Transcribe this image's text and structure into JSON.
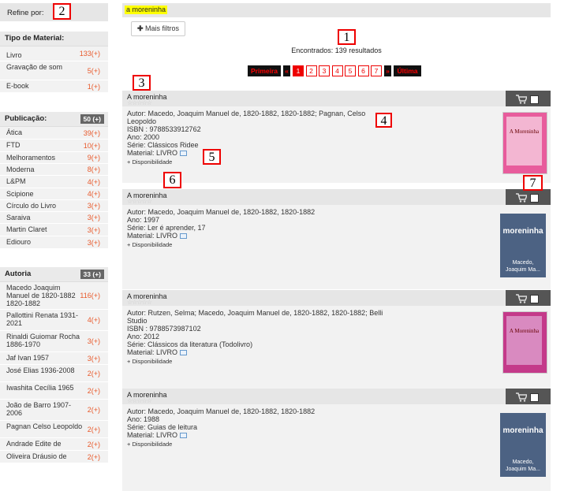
{
  "markers": [
    "1",
    "2",
    "3",
    "4",
    "5",
    "6",
    "7"
  ],
  "sidebar": {
    "refine_label": "Refine por:",
    "tipo": {
      "title": "Tipo de Material:",
      "items": [
        {
          "label": "Livro",
          "count": "133(+)"
        },
        {
          "label": "Gravação de som",
          "count": "5(+)"
        },
        {
          "label": "E-book",
          "count": "1(+)"
        }
      ]
    },
    "publicacao": {
      "title": "Publicação:",
      "count": "50 (+)",
      "items": [
        {
          "label": "Ática",
          "count": "39(+)"
        },
        {
          "label": "FTD",
          "count": "10(+)"
        },
        {
          "label": "Melhoramentos",
          "count": "9(+)"
        },
        {
          "label": "Moderna",
          "count": "8(+)"
        },
        {
          "label": "L&PM",
          "count": "4(+)"
        },
        {
          "label": "Scipione",
          "count": "4(+)"
        },
        {
          "label": "Círculo do Livro",
          "count": "3(+)"
        },
        {
          "label": "Saraiva",
          "count": "3(+)"
        },
        {
          "label": "Martin Claret",
          "count": "3(+)"
        },
        {
          "label": "Ediouro",
          "count": "3(+)"
        }
      ]
    },
    "autoria": {
      "title": "Autoria",
      "count": "33 (+)",
      "items": [
        {
          "label": "Macedo Joaquim Manuel de 1820-1882 1820-1882",
          "count": "116(+)"
        },
        {
          "label": "Pallottini Renata 1931-2021",
          "count": "4(+)"
        },
        {
          "label": "Rinaldi Guiomar Rocha 1886-1970",
          "count": "3(+)"
        },
        {
          "label": "Jaf Ivan 1957",
          "count": "3(+)"
        },
        {
          "label": "José Elias 1936-2008",
          "count": "2(+)"
        },
        {
          "label": "Iwashita Cecília 1965",
          "count": "2(+)"
        },
        {
          "label": "João de Barro 1907-2006",
          "count": "2(+)"
        },
        {
          "label": "Pagnan Celso Leopoldo",
          "count": "2(+)"
        },
        {
          "label": "Andrade Edite de",
          "count": "2(+)"
        },
        {
          "label": "Oliveira Dráusio de",
          "count": "2(+)"
        }
      ]
    }
  },
  "search": {
    "term": "a moreninha"
  },
  "filters": {
    "mais_label": "Mais filtros"
  },
  "results": {
    "found_text": "Encontrados: 139 resultados"
  },
  "pager": {
    "first": "Primeira",
    "prev": "«",
    "pages": [
      "1",
      "2",
      "3",
      "4",
      "5",
      "6",
      "7"
    ],
    "next": "»",
    "last": "Última"
  },
  "records": [
    {
      "title": "A moreninha",
      "lines": [
        "Autor: Macedo, Joaquim Manuel de, 1820-1882, 1820-1882; Pagnan, Celso",
        "Leopoldo",
        "ISBN : 9788533912762",
        "Ano: 2000",
        "Série: Clássicos Ridee"
      ],
      "material": "Material: LIVRO",
      "disp": "+ Disponibilidade",
      "cover_title": "A Moreninha"
    },
    {
      "title": "A moreninha",
      "lines": [
        "Autor: Macedo, Joaquim Manuel de, 1820-1882, 1820-1882",
        "Ano: 1997",
        "Série: Ler é aprender, 17"
      ],
      "material": "Material: LIVRO",
      "disp": "+ Disponibilidade",
      "cover_title": "moreninha",
      "cover_author": "Macedo, Joaquim Ma..."
    },
    {
      "title": "A moreninha",
      "lines": [
        "Autor: Rutzen, Selma; Macedo, Joaquim Manuel de, 1820-1882, 1820-1882; Belli",
        "Studio",
        "ISBN : 9788573987102",
        "Ano: 2012",
        "Série: Clássicos da literatura (Todolivro)"
      ],
      "material": "Material: LIVRO",
      "disp": "+ Disponibilidade",
      "cover_title": "A Moreninha"
    },
    {
      "title": "A moreninha",
      "lines": [
        "Autor: Macedo, Joaquim Manuel de, 1820-1882, 1820-1882",
        "Ano: 1988",
        "Série: Guias de leitura"
      ],
      "material": "Material: LIVRO",
      "disp": "+ Disponibilidade",
      "cover_title": "moreninha",
      "cover_author": "Macedo, Joaquim Ma..."
    }
  ]
}
